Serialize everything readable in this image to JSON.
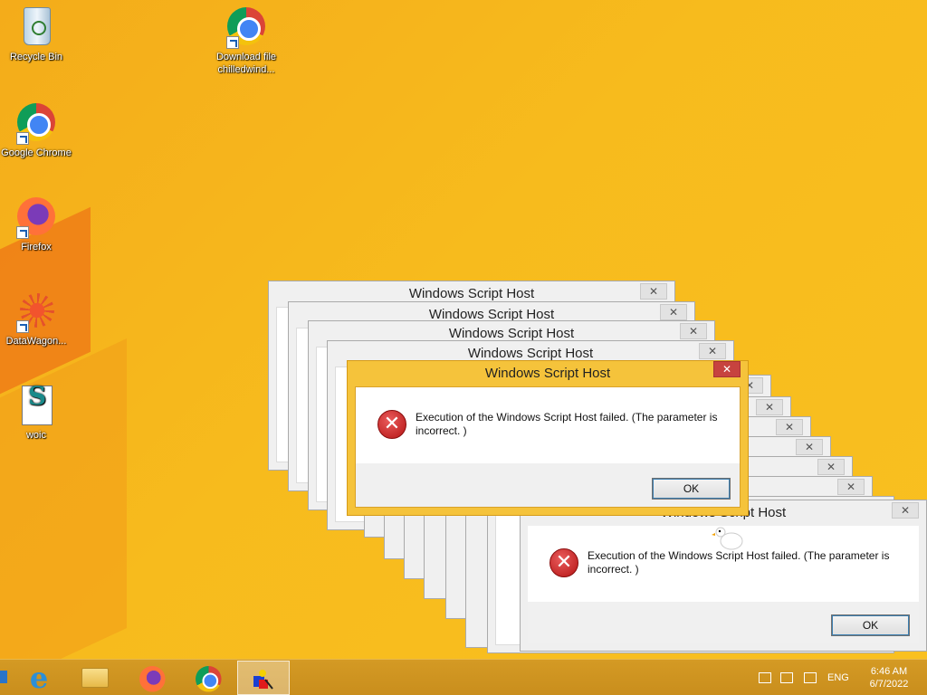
{
  "desktop": {
    "icons": [
      {
        "label": "Recycle Bin",
        "icon": "recycle-bin-icon"
      },
      {
        "label": "Download file chilledwind...",
        "icon": "chrome-shortcut-icon"
      },
      {
        "label": "Google Chrome",
        "icon": "chrome-icon"
      },
      {
        "label": "Firefox",
        "icon": "firefox-icon"
      },
      {
        "label": "DataWagon...",
        "icon": "datawagon-icon"
      },
      {
        "label": "woic",
        "icon": "script-file-icon"
      }
    ]
  },
  "dialog": {
    "title": "Windows Script Host",
    "close_label": "✕",
    "message": "Execution of the Windows Script Host failed. (The parameter is incorrect. )",
    "ok_label": "OK"
  },
  "taskbar": {
    "pinned": [
      {
        "icon": "internet-explorer-icon"
      },
      {
        "icon": "file-explorer-icon"
      },
      {
        "icon": "firefox-icon"
      },
      {
        "icon": "chrome-icon"
      },
      {
        "icon": "script-host-app-icon",
        "active": true
      }
    ],
    "tray": {
      "language": "ENG",
      "time": "6:46 AM",
      "date": "6/7/2022"
    }
  },
  "colors": {
    "desktop_bg": "#f6b81a",
    "active_title": "#f5c33b",
    "close_active": "#c7433f"
  }
}
